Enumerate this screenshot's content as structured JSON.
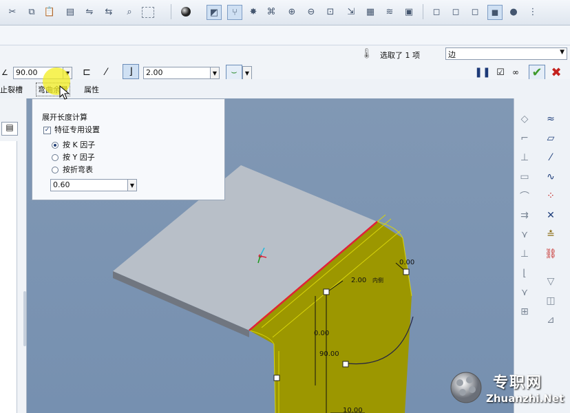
{
  "toolbar": {
    "icons": [
      "cut-icon",
      "copy-icon",
      "paste-icon",
      "paste-special-icon",
      "regenerate-icon",
      "regen-manager-icon",
      "find-icon",
      "select-box-icon",
      "sphere-icon",
      "planes-toggle-icon",
      "axes-toggle-icon",
      "points-toggle-icon",
      "csys-toggle-icon",
      "zoom-in-icon",
      "zoom-out-icon",
      "refit-icon",
      "orient-icon",
      "named-views-icon",
      "layers-icon",
      "appearance-icon",
      "wireframe-icon",
      "hidden-line-icon",
      "no-hidden-icon",
      "shading-icon",
      "display-style-icon"
    ]
  },
  "status": {
    "selection_text": "选取了 1 项",
    "filter_value": "边"
  },
  "dashboard": {
    "angle_value": "90.00",
    "radius_value": "2.00"
  },
  "tabs": {
    "left_cut": "止裂槽",
    "bend_allowance": "弯曲余量",
    "properties": "属性"
  },
  "popup": {
    "title": "展开长度计算",
    "feature_setting": "特征专用设置",
    "option_k": "按 K 因子",
    "option_y": "按 Y 因子",
    "option_table": "按折弯表",
    "factor_value": "0.60"
  },
  "viewport": {
    "dim_radius": "2.00",
    "dim_radius_suffix": "内侧",
    "dim_top": "0.00",
    "dim_mid": "0.00",
    "dim_angle": "90.00",
    "dim_bottom": "10.00"
  },
  "watermark": {
    "cn": "专职网",
    "url": "Zhuanzhi.Net"
  },
  "colors": {
    "viewport_bg": "#7f97b4",
    "sheet_top": "#b8bfc8",
    "bend_yellow": "#9c9700",
    "edge_red": "#e0203a",
    "accept_green": "#3e9a2d",
    "cancel_red": "#c4221e",
    "highlight_yellow": "#f3ee1f"
  }
}
